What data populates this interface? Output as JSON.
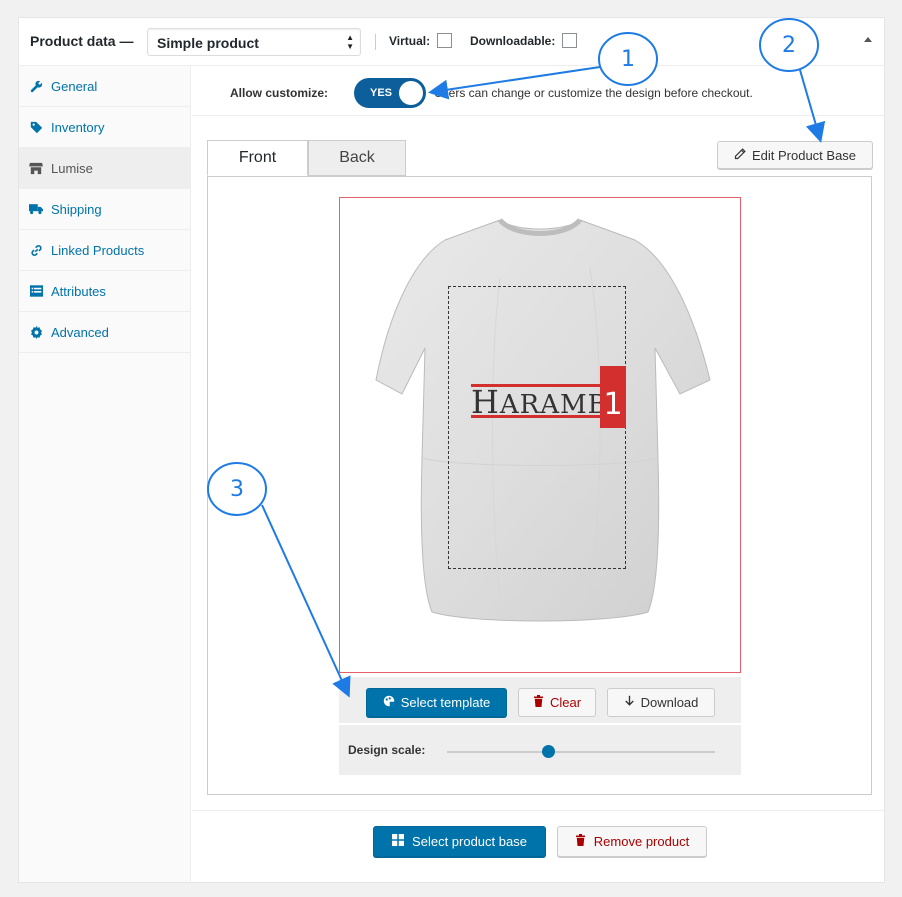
{
  "header": {
    "title": "Product data —",
    "product_type": "Simple product",
    "virtual_label": "Virtual:",
    "downloadable_label": "Downloadable:"
  },
  "sidebar": {
    "items": [
      {
        "label": "General",
        "icon": "wrench-icon"
      },
      {
        "label": "Inventory",
        "icon": "tag-icon"
      },
      {
        "label": "Lumise",
        "icon": "store-icon"
      },
      {
        "label": "Shipping",
        "icon": "truck-icon"
      },
      {
        "label": "Linked Products",
        "icon": "link-icon"
      },
      {
        "label": "Attributes",
        "icon": "list-icon"
      },
      {
        "label": "Advanced",
        "icon": "gear-icon"
      }
    ]
  },
  "customize": {
    "label": "Allow customize:",
    "toggle_text": "YES",
    "description": "Users can change or customize the design before checkout."
  },
  "tabs": {
    "front": "Front",
    "back": "Back"
  },
  "edit_base_label": "Edit Product Base",
  "design": {
    "logo_text": "HARAMBE",
    "logo_first": "H",
    "logo_rest": "ARAMBE",
    "logo_badge": "1"
  },
  "controls": {
    "select_template": "Select template",
    "clear": "Clear",
    "download": "Download",
    "design_scale_label": "Design scale:",
    "design_scale_value": 0.38
  },
  "bottom": {
    "select_product_base": "Select product base",
    "remove_product": "Remove product"
  },
  "callouts": [
    "1",
    "2",
    "3"
  ],
  "colors": {
    "accent": "#0073aa",
    "toggle": "#0c5f9a",
    "danger": "#aa0000",
    "annotation": "#1e7be5",
    "logo_red": "#d32f2f"
  }
}
